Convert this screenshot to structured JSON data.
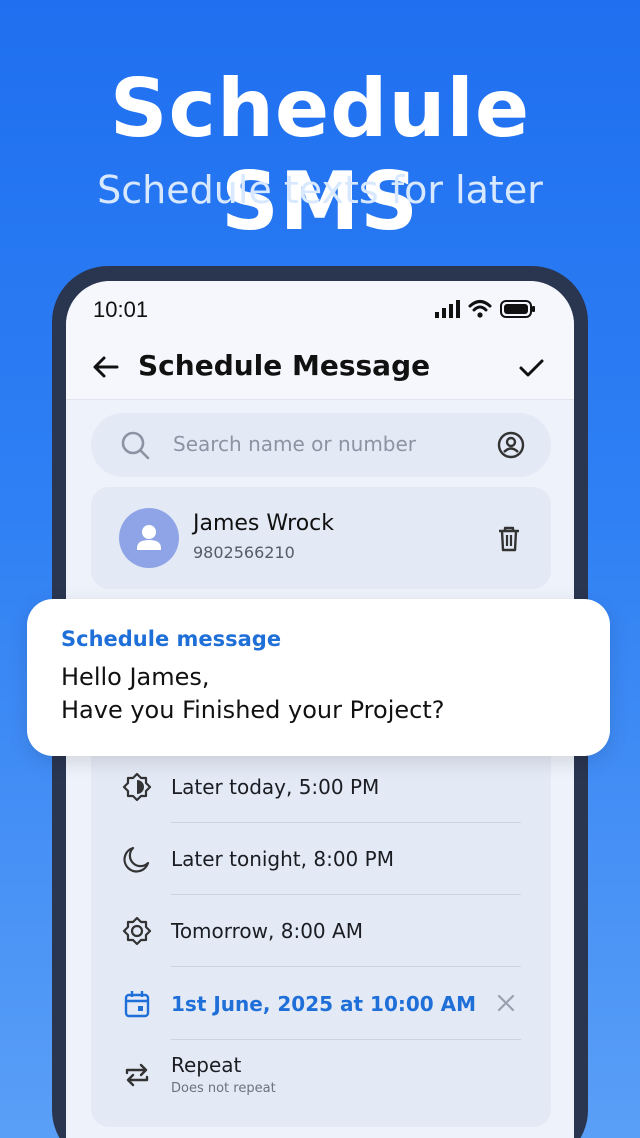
{
  "hero": {
    "title": "Schedule SMS",
    "subtitle": "Schedule texts for later"
  },
  "status_bar": {
    "time": "10:01",
    "icons": [
      "signal-icon",
      "wifi-icon",
      "battery-icon"
    ]
  },
  "appbar": {
    "title": "Schedule Message",
    "back_icon": "arrow-left-icon",
    "confirm_icon": "check-icon"
  },
  "search": {
    "placeholder": "Search name or number"
  },
  "contact": {
    "name": "James Wrock",
    "number": "9802566210"
  },
  "message": {
    "title": "Schedule message",
    "text": "Hello James,\nHave you Finished your Project?"
  },
  "options": [
    {
      "label": "Later today, 5:00 PM",
      "icon": "brightness-icon"
    },
    {
      "label": "Later tonight, 8:00 PM",
      "icon": "moon-icon"
    },
    {
      "label": "Tomorrow, 8:00 AM",
      "icon": "sun-gear-icon"
    },
    {
      "label": "1st June, 2025 at 10:00 AM",
      "icon": "calendar-icon",
      "active": true
    },
    {
      "label": "Repeat",
      "sublabel": "Does not repeat",
      "icon": "repeat-icon"
    }
  ],
  "colors": {
    "accent": "#1f6fd8",
    "background_top": "#1f6ff0",
    "phone_frame": "#2a3550"
  }
}
